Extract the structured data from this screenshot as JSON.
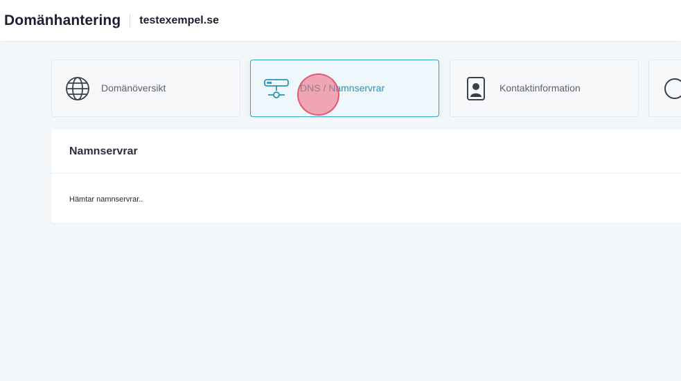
{
  "header": {
    "title": "Domänhantering",
    "domain": "testexempel.se"
  },
  "tabs": [
    {
      "label": "Domänöversikt",
      "icon": "globe-icon",
      "active": false
    },
    {
      "label": "DNS / Namnservrar",
      "icon": "server-network-icon",
      "active": true
    },
    {
      "label": "Kontaktinformation",
      "icon": "contact-card-icon",
      "active": false
    },
    {
      "label": "",
      "icon": "circle-icon",
      "active": false
    }
  ],
  "card": {
    "title": "Namnservrar",
    "status_text": "Hämtar namnservrar.."
  },
  "colors": {
    "accent": "#2ea3c4",
    "background": "#f4f7fa",
    "click_marker": "#f06078"
  }
}
